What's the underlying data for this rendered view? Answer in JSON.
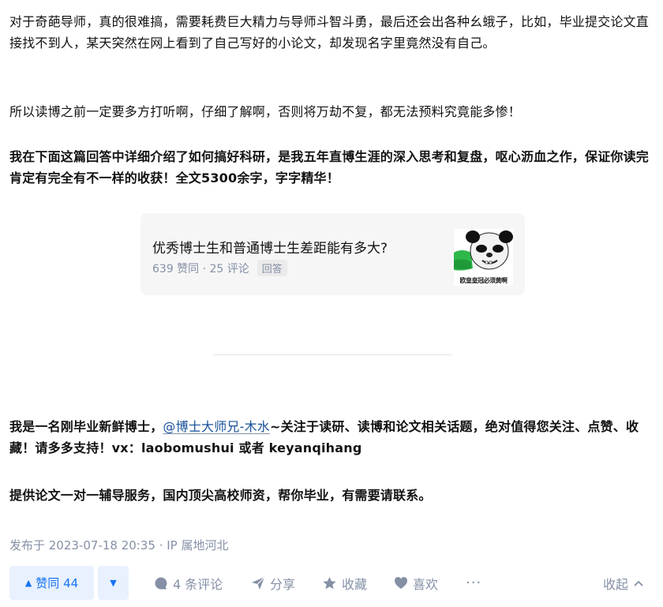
{
  "paragraphs": {
    "p1": "对于奇葩导师，真的很难搞，需要耗费巨大精力与导师斗智斗勇，最后还会出各种幺蛾子，比如，毕业提交论文直接找不到人，某天突然在网上看到了自己写好的小论文，却发现名字里竟然没有自己。",
    "p2": "所以读博之前一定要多方打听啊，仔细了解啊，否则将万劫不复，都无法预料究竟能多惨！",
    "p3": "我在下面这篇回答中详细介绍了如何搞好科研，是我五年直博生涯的深入思考和复盘，呕心沥血之作，保证你读完肯定有完全有不一样的收获！全文5300余字，字字精华！",
    "p4_before": "我是一名刚毕业新鲜博士，",
    "p4_mention": "@博士大师兄-木水",
    "p4_after": "~关注于读研、读博和论文相关话题，绝对值得您关注、点赞、收藏！请多多支持！vx：laobomushui 或者 keyanqihang",
    "p5": "提供论文一对一辅导服务，国内顶尖高校师资，帮你毕业，有需要请联系。"
  },
  "link_card": {
    "title": "优秀博士生和普通博士生差距能有多大?",
    "meta": "639 赞同 · 25 评论",
    "tag": "回答",
    "thumbnail_caption": "欧皇皇冠必须黄啊",
    "thumbnail_icon": "panda-meme-icon"
  },
  "publish_info": "发布于 2023-07-18 20:35 · IP 属地河北",
  "actions": {
    "vote_up": "赞同 44",
    "comment": "4 条评论",
    "share": "分享",
    "favorite": "收藏",
    "like": "喜欢",
    "more": "···",
    "collapse": "收起"
  },
  "colors": {
    "text": "#121212",
    "secondary": "#8590a6",
    "accent": "#1772f6",
    "accent_bg": "#e8f1fd",
    "link": "#175199",
    "card_bg": "#f6f6f6"
  }
}
